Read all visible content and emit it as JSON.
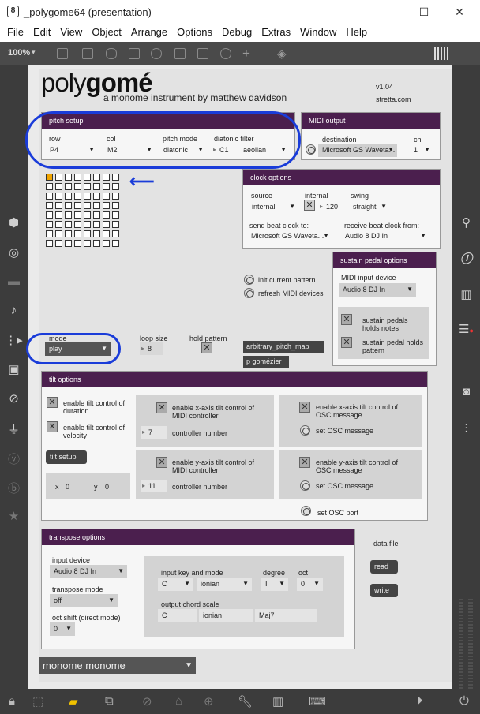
{
  "window": {
    "title": "_polygome64 (presentation)",
    "app_icon": "max-icon",
    "controls": [
      "minimize-icon",
      "maximize-icon",
      "close-icon"
    ]
  },
  "menu": [
    "File",
    "Edit",
    "View",
    "Object",
    "Arrange",
    "Options",
    "Debug",
    "Extras",
    "Window",
    "Help"
  ],
  "toolbar": {
    "zoom": "100%"
  },
  "header": {
    "logo_light": "poly",
    "logo_bold": "gomé",
    "subtitle": "a monome instrument by matthew davidson",
    "version": "v1.04",
    "site": "stretta.com"
  },
  "pitch_setup": {
    "title": "pitch setup",
    "row_label": "row",
    "row_value": "P4",
    "col_label": "col",
    "col_value": "M2",
    "mode_label": "pitch mode",
    "mode_value": "diatonic",
    "filter_label": "diatonic filter",
    "filter_key": "C1",
    "filter_scale": "aeolian"
  },
  "midi_output": {
    "title": "MIDI output",
    "dest_label": "destination",
    "dest_value": "Microsoft GS Waveta...",
    "ch_label": "ch",
    "ch_value": "1"
  },
  "clock": {
    "title": "clock options",
    "source_label": "source",
    "source_value": "internal",
    "internal_label": "internal",
    "bpm": "120",
    "swing_label": "swing",
    "swing_value": "straight",
    "send_label": "send beat clock to:",
    "send_value": "Microsoft GS Waveta...",
    "recv_label": "receive beat clock from:",
    "recv_value": "Audio 8 DJ In"
  },
  "actions": {
    "init_pattern": "init current pattern",
    "refresh_midi": "refresh MIDI devices",
    "arb_map": "arbitrary_pitch_map",
    "gomeizer": "p gomézier"
  },
  "sustain": {
    "title": "sustain pedal options",
    "input_label": "MIDI input device",
    "input_value": "Audio 8 DJ In",
    "holds_notes": "sustain pedals holds notes",
    "holds_pattern": "sustain pedal holds pattern"
  },
  "mode": {
    "mode_label": "mode",
    "mode_value": "play",
    "loop_label": "loop size",
    "loop_value": "8",
    "hold_label": "hold pattern"
  },
  "tilt": {
    "title": "tilt options",
    "dur": "enable tilt control of duration",
    "vel": "enable tilt control of velocity",
    "setup": "tilt setup",
    "x_label": "x",
    "x_value": "0",
    "y_label": "y",
    "y_value": "0",
    "xmidi": "enable x-axis tilt control of MIDI controller",
    "xcc": "7",
    "cc_label": "controller number",
    "ymidi": "enable y-axis tilt control of MIDI controller",
    "ycc": "11",
    "xosc": "enable x-axis tilt control of OSC message",
    "yosc": "enable y-axis tilt control of OSC message",
    "set_osc": "set OSC message",
    "set_port": "set OSC port"
  },
  "transpose": {
    "title": "transpose options",
    "input_label": "input device",
    "input_value": "Audio 8 DJ In",
    "mode_label": "transpose mode",
    "mode_value": "off",
    "oct_label": "oct shift (direct mode)",
    "oct_value": "0",
    "keymode_label": "input key and mode",
    "key_value": "C",
    "scale_value": "ionian",
    "degree_label": "degree",
    "degree_value": "I",
    "oct2_label": "oct",
    "oct2_value": "0",
    "chord_label": "output chord scale",
    "chord_key": "C",
    "chord_scale": "ionian",
    "chord_type": "Maj7"
  },
  "datafile": {
    "title": "data file",
    "read": "read",
    "write": "write"
  },
  "device": {
    "value": "monome monome"
  },
  "grid": {
    "rows": 8,
    "cols": 8,
    "lit": [
      [
        0,
        0
      ]
    ],
    "lit_color": "#f0a400"
  },
  "annotation_color": "#1a3cd9"
}
